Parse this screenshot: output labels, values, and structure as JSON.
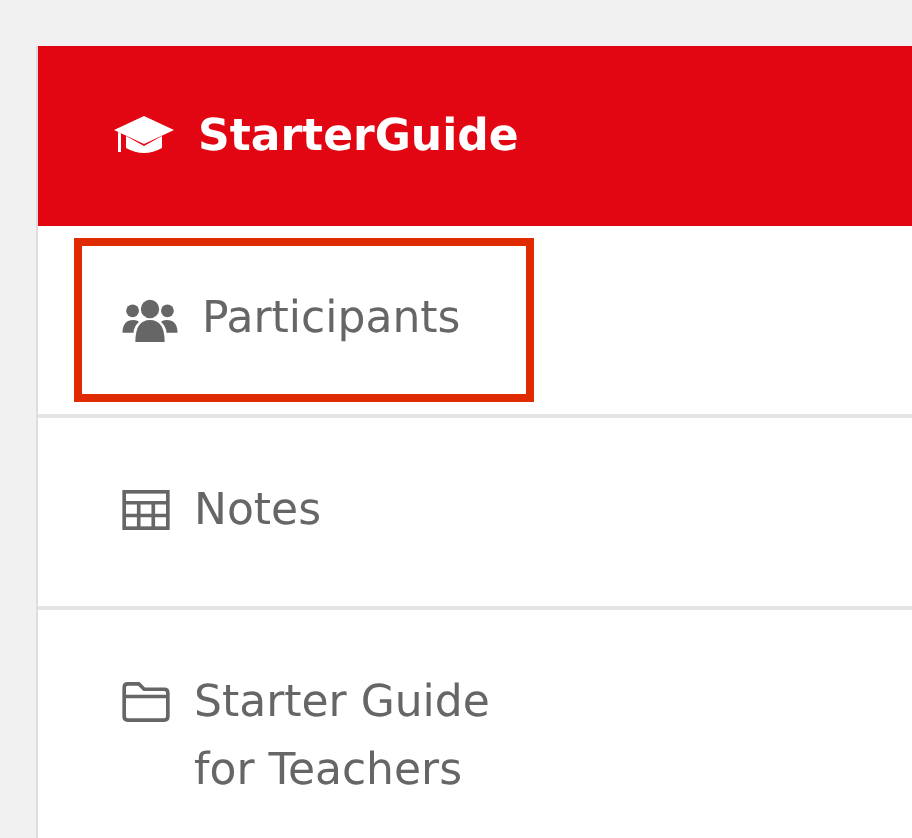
{
  "header": {
    "title": "StarterGuide"
  },
  "items": [
    {
      "label": "Participants",
      "kind": "group",
      "highlighted": true
    },
    {
      "label": "Notes",
      "kind": "table",
      "highlighted": false
    },
    {
      "label": "Starter Guide for Teachers",
      "kind": "folder",
      "highlighted": false
    }
  ]
}
